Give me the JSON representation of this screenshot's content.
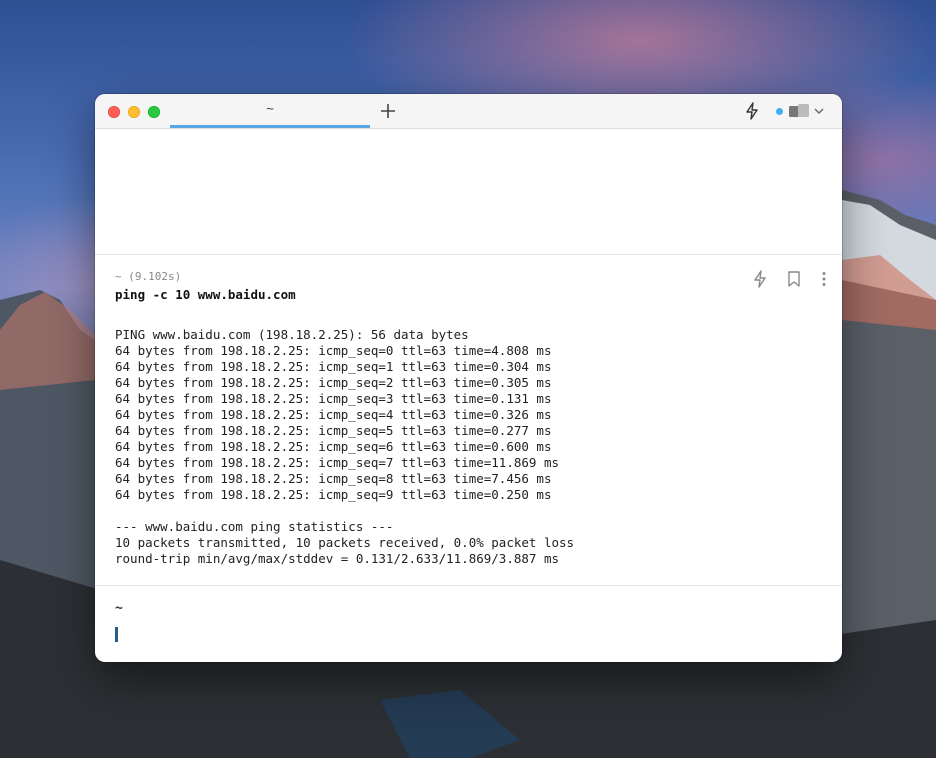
{
  "window": {
    "tab_title": "~",
    "new_tab_symbol": "+"
  },
  "toolbar_icons": [
    "bolt-icon",
    "status-dot",
    "pane-layout-icon",
    "chevron-down-icon"
  ],
  "block": {
    "meta": "~ (9.102s)",
    "command": "ping -c 10 www.baidu.com",
    "actions": [
      "bolt-icon",
      "bookmark-icon",
      "more-vertical-icon"
    ],
    "output_lines": [
      "PING www.baidu.com (198.18.2.25): 56 data bytes",
      "64 bytes from 198.18.2.25: icmp_seq=0 ttl=63 time=4.808 ms",
      "64 bytes from 198.18.2.25: icmp_seq=1 ttl=63 time=0.304 ms",
      "64 bytes from 198.18.2.25: icmp_seq=2 ttl=63 time=0.305 ms",
      "64 bytes from 198.18.2.25: icmp_seq=3 ttl=63 time=0.131 ms",
      "64 bytes from 198.18.2.25: icmp_seq=4 ttl=63 time=0.326 ms",
      "64 bytes from 198.18.2.25: icmp_seq=5 ttl=63 time=0.277 ms",
      "64 bytes from 198.18.2.25: icmp_seq=6 ttl=63 time=0.600 ms",
      "64 bytes from 198.18.2.25: icmp_seq=7 ttl=63 time=11.869 ms",
      "64 bytes from 198.18.2.25: icmp_seq=8 ttl=63 time=7.456 ms",
      "64 bytes from 198.18.2.25: icmp_seq=9 ttl=63 time=0.250 ms",
      "",
      "--- www.baidu.com ping statistics ---",
      "10 packets transmitted, 10 packets received, 0.0% packet loss",
      "round-trip min/avg/max/stddev = 0.131/2.633/11.869/3.887 ms"
    ]
  },
  "prompt": {
    "directory": "~"
  },
  "colors": {
    "tab_underline": "#59a7e4",
    "status_dot": "#3bb0f0",
    "cursor": "#2a5d86"
  }
}
